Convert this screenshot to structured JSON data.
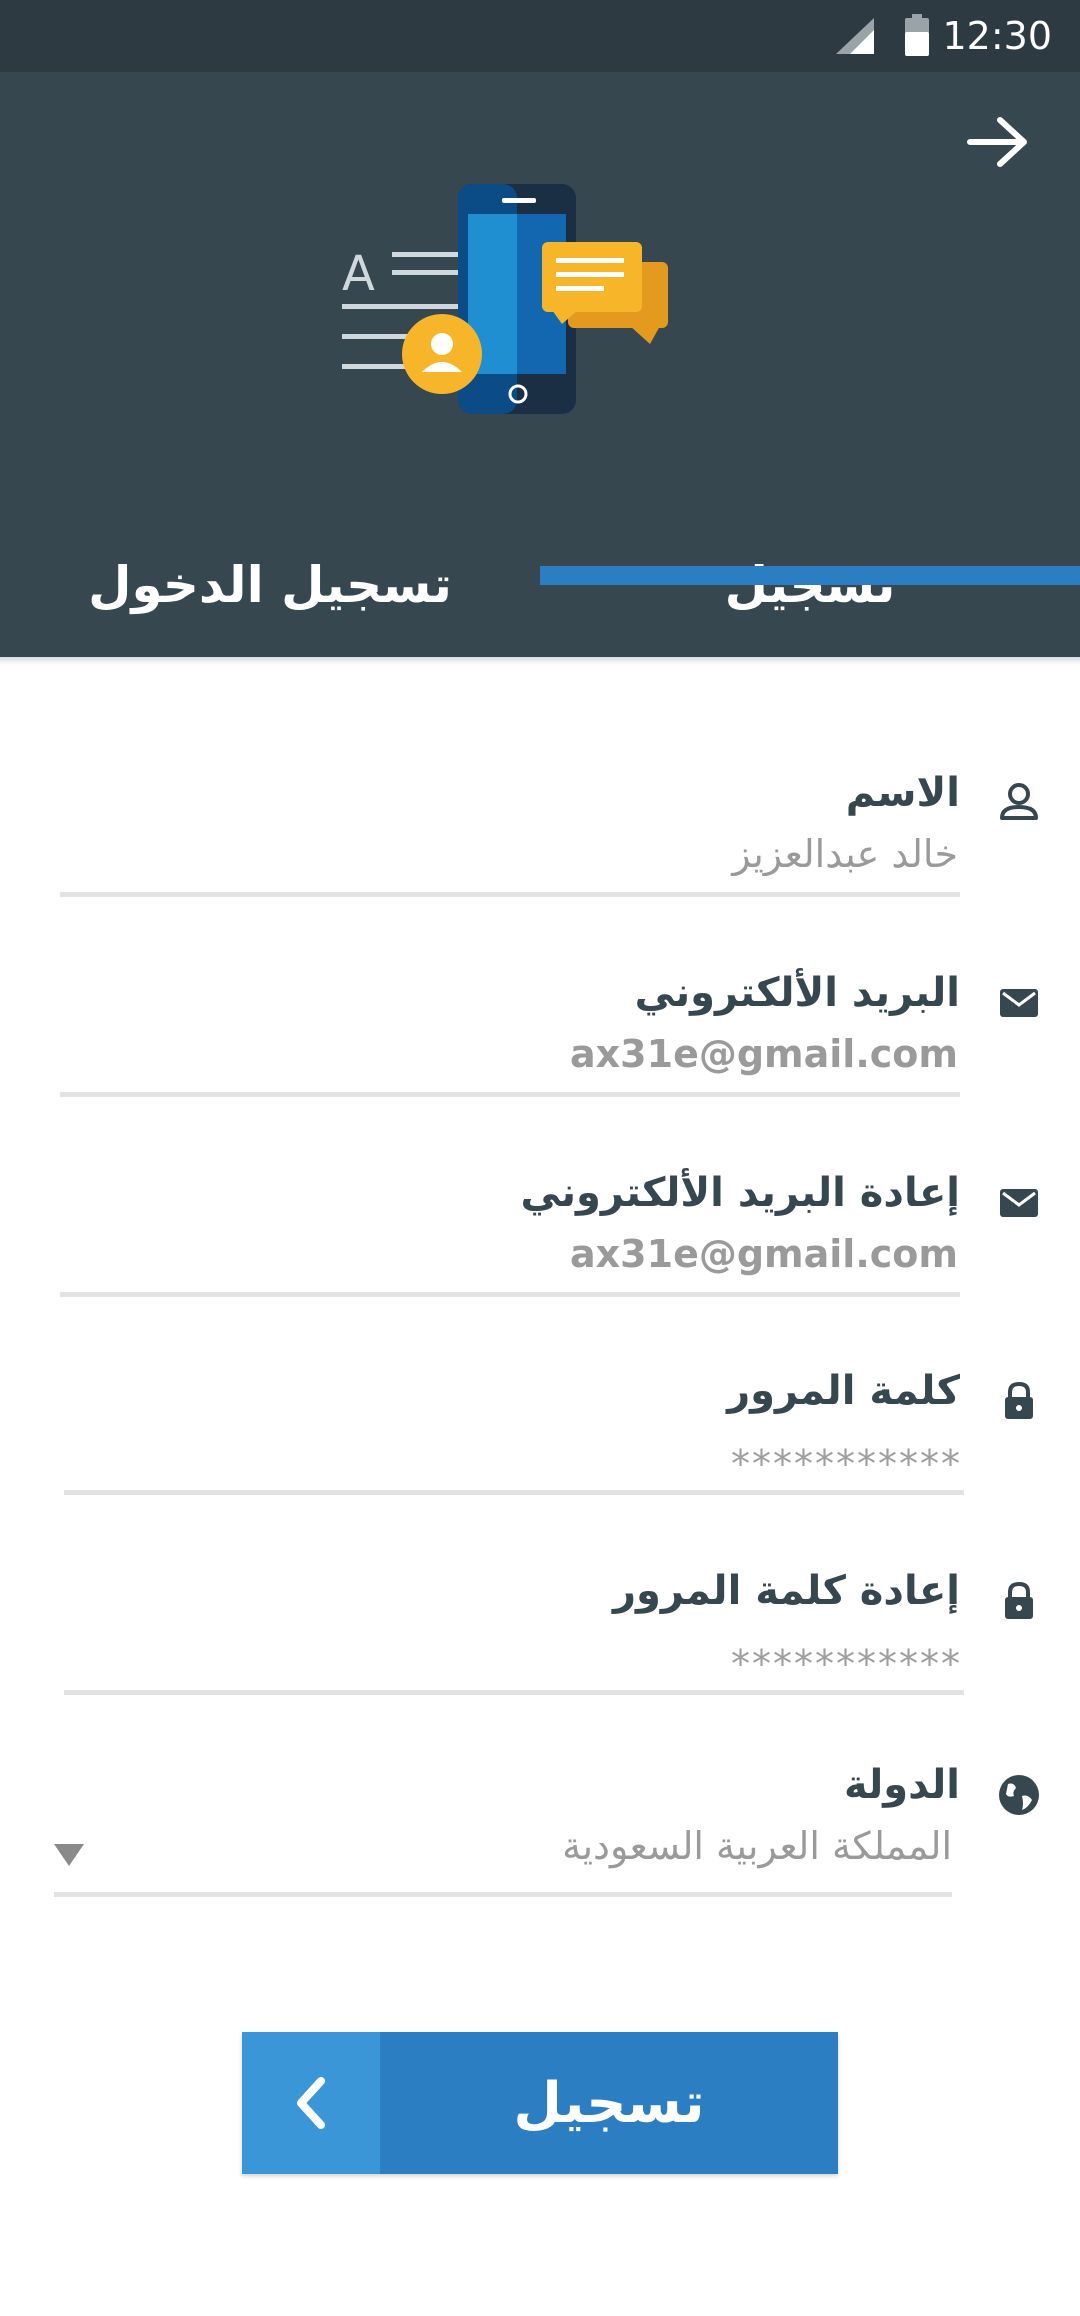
{
  "status_bar": {
    "time": "12:30"
  },
  "tabs": {
    "login": "تسجيل الدخول",
    "register": "تسجيل"
  },
  "form": {
    "name": {
      "label": "الاسم",
      "value": "خالد عبدالعزيز",
      "icon": "person-icon"
    },
    "email": {
      "label": "البريد الألكتروني",
      "value": "ax31e@gmail.com",
      "icon": "mail-icon"
    },
    "email_confirm": {
      "label": "إعادة البريد الألكتروني",
      "value": "ax31e@gmail.com",
      "icon": "mail-icon"
    },
    "password": {
      "label": "كلمة المرور",
      "value": "***********",
      "icon": "lock-icon"
    },
    "password_confirm": {
      "label": "إعادة كلمة المرور",
      "value": "***********",
      "icon": "lock-icon"
    },
    "country": {
      "label": "الدولة",
      "value": "المملكة العربية السعودية",
      "icon": "globe-icon"
    }
  },
  "submit": {
    "label": "تسجيل"
  },
  "colors": {
    "header": "#37474f",
    "status_bar": "#2e3a42",
    "accent": "#2b7ec2",
    "accent_light": "#3a96d6"
  }
}
